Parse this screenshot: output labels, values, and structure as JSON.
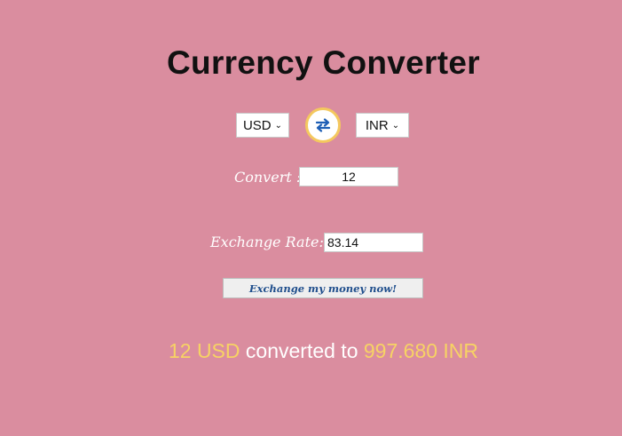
{
  "page": {
    "title": "Currency Converter"
  },
  "converter": {
    "from_currency": "USD",
    "to_currency": "INR",
    "swap_icon": "swap-arrows-icon",
    "convert_label": "Convert :",
    "amount_value": "12",
    "rate_label": "Exchange Rate:",
    "rate_value": "83.14",
    "button_label": "Exchange my money now!"
  },
  "result": {
    "from_part": "12 USD",
    "middle_text": "converted to",
    "to_part": "997.680 INR"
  },
  "colors": {
    "background": "#da8d9f",
    "highlight": "#f7d364",
    "swap_border": "#f4c85e",
    "swap_icon": "#1f5fb5",
    "button_text": "#1f4e8c"
  }
}
